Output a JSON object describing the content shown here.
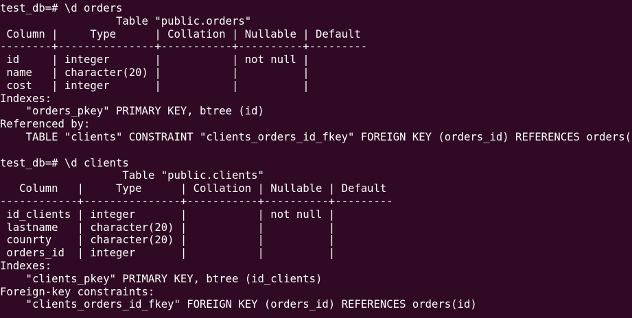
{
  "terminal": {
    "background": "#300a24",
    "foreground": "#ffffff",
    "lines": [
      "test_db=# \\d orders",
      "                  Table \"public.orders\"",
      " Column |     Type      | Collation | Nullable | Default ",
      "--------+---------------+-----------+----------+---------",
      " id     | integer       |           | not null |",
      " name   | character(20) |           |          |",
      " cost   | integer       |           |          |",
      "Indexes:",
      "    \"orders_pkey\" PRIMARY KEY, btree (id)",
      "Referenced by:",
      "    TABLE \"clients\" CONSTRAINT \"clients_orders_id_fkey\" FOREIGN KEY (orders_id) REFERENCES orders(id)",
      "",
      "test_db=# \\d clients",
      "                   Table \"public.clients\"",
      "   Column   |     Type      | Collation | Nullable | Default ",
      "------------+---------------+-----------+----------+---------",
      " id_clients | integer       |           | not null |",
      " lastname   | character(20) |           |          |",
      " counrty    | character(20) |           |          |",
      " orders_id  | integer       |           |          |",
      "Indexes:",
      "    \"clients_pkey\" PRIMARY KEY, btree (id_clients)",
      "Foreign-key constraints:",
      "    \"clients_orders_id_fkey\" FOREIGN KEY (orders_id) REFERENCES orders(id)"
    ]
  }
}
